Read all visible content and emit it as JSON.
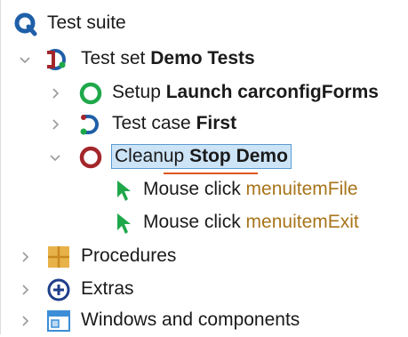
{
  "tree": {
    "root": {
      "label": "Test suite",
      "icon": "qftest-suite-icon"
    },
    "test_set": {
      "prefix": "Test set",
      "name": "Demo Tests",
      "icon": "test-set-icon"
    },
    "setup": {
      "prefix": "Setup",
      "name": "Launch carconfigForms",
      "icon": "setup-circle-icon"
    },
    "test_case": {
      "prefix": "Test case",
      "name": "First",
      "icon": "test-case-icon"
    },
    "cleanup": {
      "prefix": "Cleanup",
      "name": "Stop Demo",
      "icon": "cleanup-circle-icon"
    },
    "mouse_click_1": {
      "prefix": "Mouse click",
      "target": "menuitemFile",
      "icon": "mouse-click-icon"
    },
    "mouse_click_2": {
      "prefix": "Mouse click",
      "target": "menuitemExit",
      "icon": "mouse-click-icon"
    },
    "procedures": {
      "label": "Procedures",
      "icon": "procedures-icon"
    },
    "extras": {
      "label": "Extras",
      "icon": "extras-icon"
    },
    "windows": {
      "label": "Windows and components",
      "icon": "windows-components-icon"
    }
  },
  "colors": {
    "selection_bg": "#cde4f7",
    "selection_border": "#5b9bd5",
    "argument_text": "#a8741a",
    "setup_green": "#1fa84a",
    "cleanup_red": "#a3262a",
    "qf_blue": "#1f5fa8"
  }
}
